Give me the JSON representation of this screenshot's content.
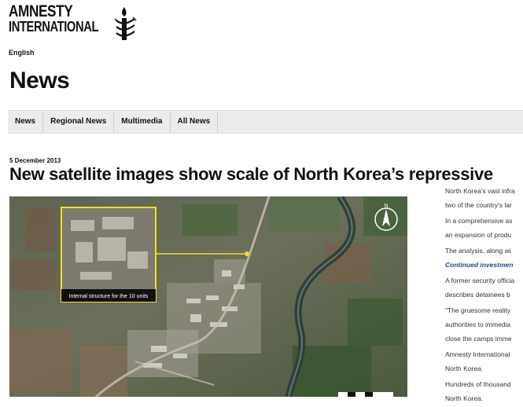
{
  "header": {
    "logo_line1": "AMNESTY",
    "logo_line2": "INTERNATIONAL",
    "language": "English",
    "page_title": "News"
  },
  "nav": {
    "items": [
      {
        "label": "News"
      },
      {
        "label": "Regional News"
      },
      {
        "label": "Multimedia"
      },
      {
        "label": "All News"
      }
    ]
  },
  "article": {
    "date": "5 December 2013",
    "headline": "New satellite images show scale of North Korea’s repressive",
    "image": {
      "callout_label": "Internal structure for the 10 units",
      "compass_letter": "N"
    },
    "sidebar": [
      {
        "text": "North Korea's vast infra"
      },
      {
        "text": "two of the country's lar"
      },
      {
        "text": "In a comprehensive as"
      },
      {
        "text": "an expansion of produ"
      },
      {
        "text": "The analysis, along wi"
      },
      {
        "text": "Continued investmen"
      },
      {
        "text": "A former security officia"
      },
      {
        "text": "describes detainees b"
      },
      {
        "text": "\"The gruesome reality"
      },
      {
        "text": "authorities to immedia"
      },
      {
        "text": "close the camps imme"
      },
      {
        "text": "Amnesty International"
      },
      {
        "text": "North Korea."
      },
      {
        "text": "Hundreds of thousand"
      },
      {
        "text": "North Korea."
      }
    ]
  },
  "colors": {
    "nav_background": "#ececec",
    "callout_yellow": "#f0e020",
    "link_blue": "#1b4e8c"
  }
}
